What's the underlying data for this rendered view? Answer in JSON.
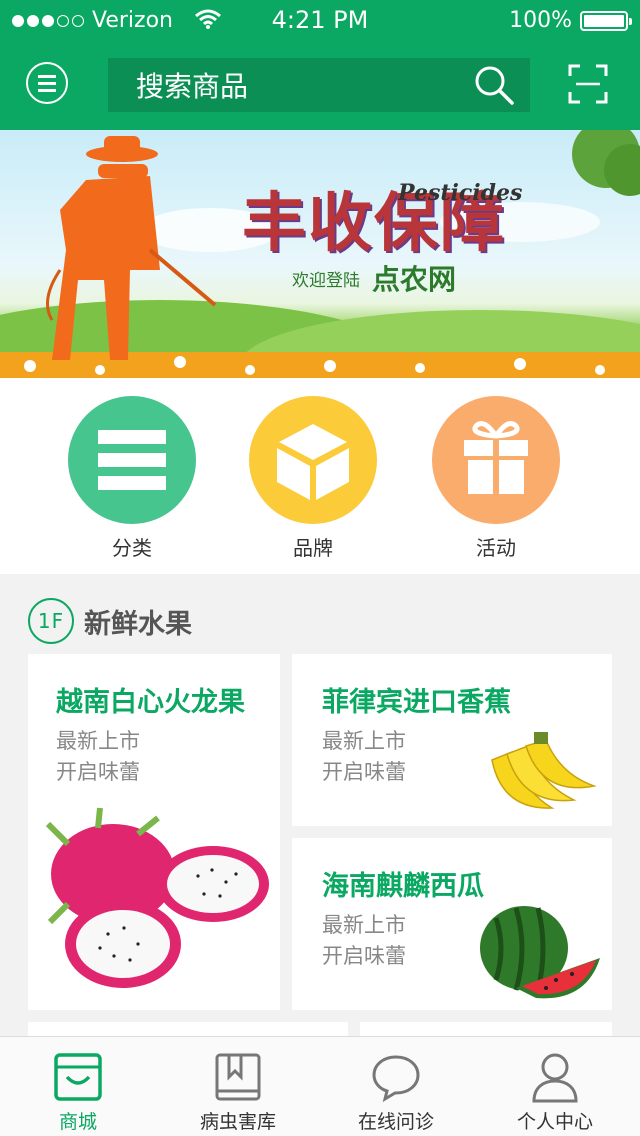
{
  "status_bar": {
    "carrier": "Verizon",
    "time": "4:21 PM",
    "battery": "100%"
  },
  "header": {
    "search_placeholder": "搜索商品"
  },
  "banner": {
    "main_text": "丰收保障",
    "en_text": "Pesticides",
    "welcome_text": "欢迎登陆",
    "site_name": "点农网"
  },
  "quick_links": [
    {
      "label": "分类",
      "icon": "list-icon",
      "color": "#46c58f"
    },
    {
      "label": "品牌",
      "icon": "box-icon",
      "color": "#fbcb3a"
    },
    {
      "label": "活动",
      "icon": "gift-icon",
      "color": "#f9ac6c"
    }
  ],
  "section": {
    "floor": "1F",
    "title": "新鲜水果"
  },
  "products": [
    {
      "name": "越南白心火龙果",
      "line1": "最新上市",
      "line2": "开启味蕾",
      "image": "dragon-fruit"
    },
    {
      "name": "菲律宾进口香蕉",
      "line1": "最新上市",
      "line2": "开启味蕾",
      "image": "banana"
    },
    {
      "name": "海南麒麟西瓜",
      "line1": "最新上市",
      "line2": "开启味蕾",
      "image": "watermelon"
    }
  ],
  "tabs": [
    {
      "label": "商城",
      "icon": "store-icon",
      "active": true
    },
    {
      "label": "病虫害库",
      "icon": "book-icon",
      "active": false
    },
    {
      "label": "在线问诊",
      "icon": "chat-icon",
      "active": false
    },
    {
      "label": "个人中心",
      "icon": "user-icon",
      "active": false
    }
  ],
  "colors": {
    "brand_green": "#0aa862",
    "search_bg": "#0b8f55",
    "inactive_tab": "#777777"
  }
}
